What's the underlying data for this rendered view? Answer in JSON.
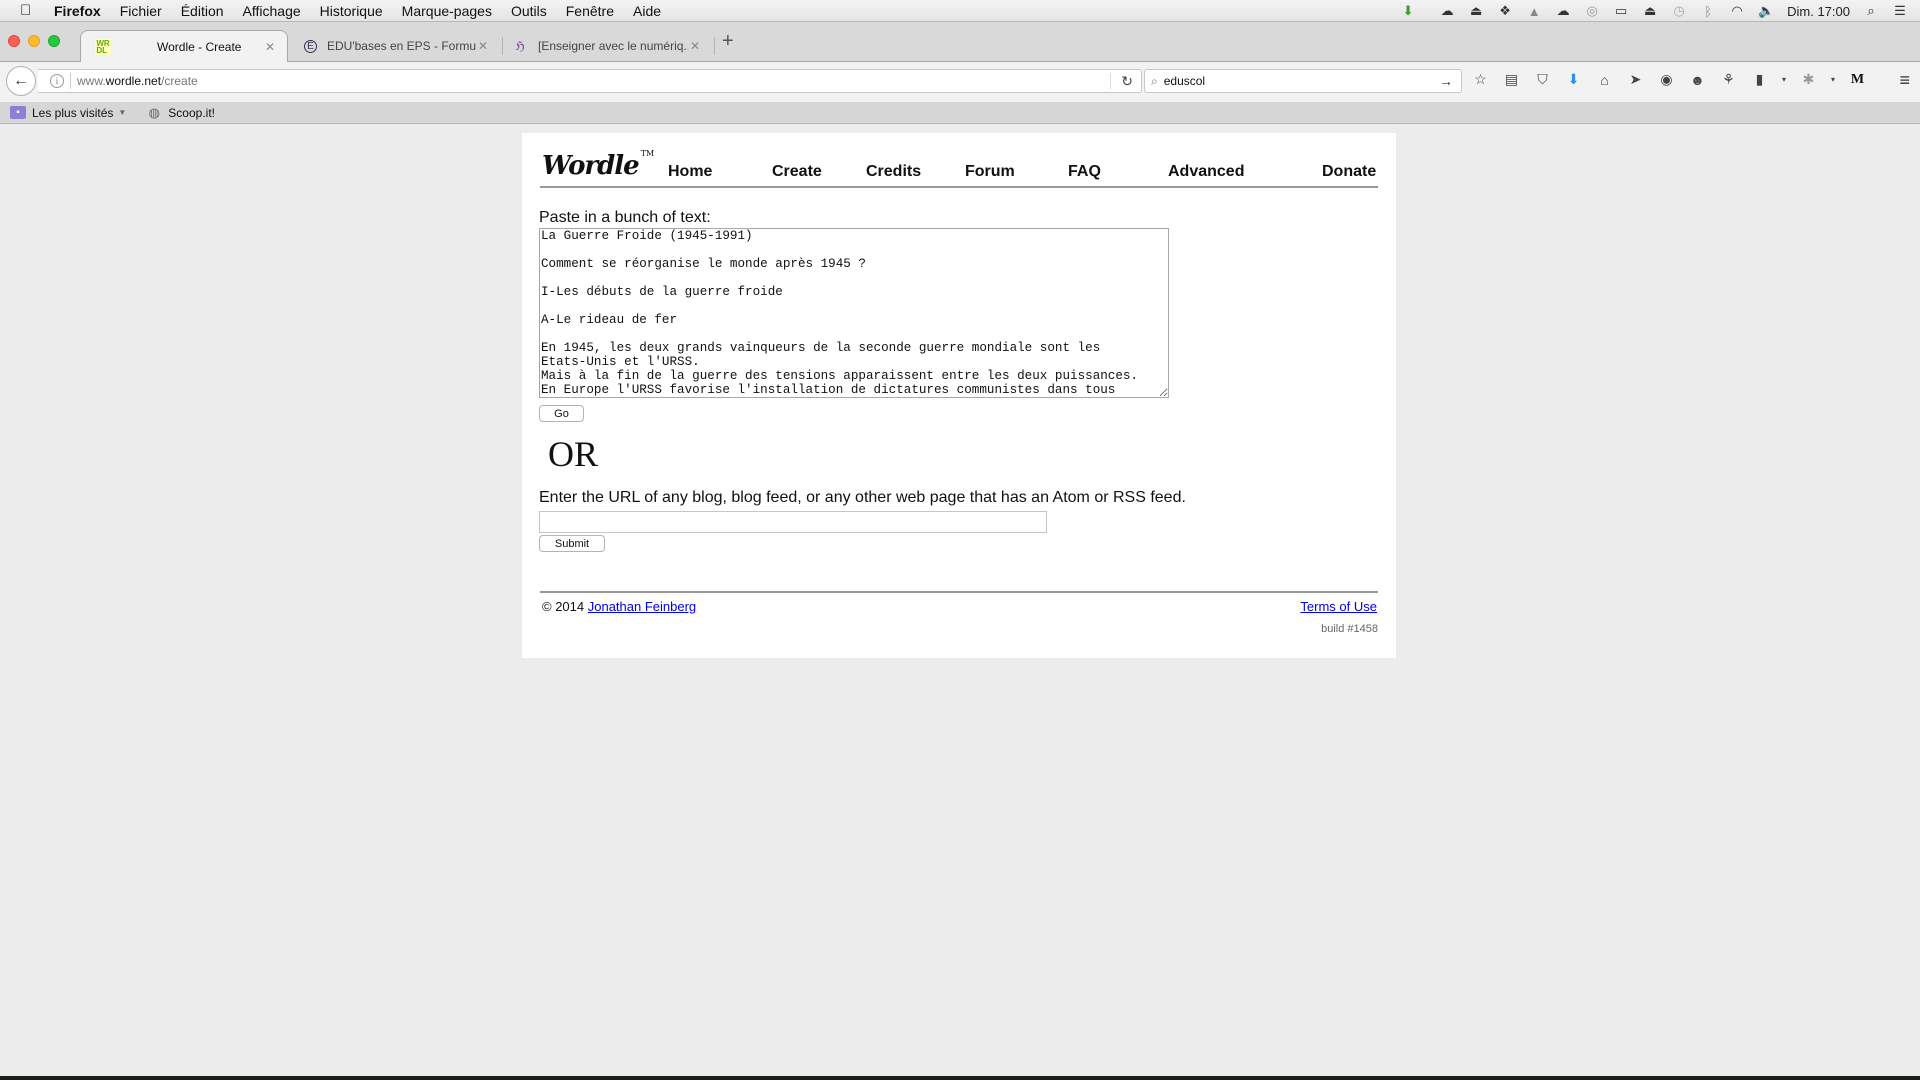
{
  "menubar": {
    "apple_icon": "",
    "app_name": "Firefox",
    "items": [
      "Fichier",
      "Édition",
      "Affichage",
      "Historique",
      "Marque-pages",
      "Outils",
      "Fenêtre",
      "Aide"
    ],
    "status_icons": [
      "download-tray-icon",
      "cloud-icon",
      "airdrop-box-icon",
      "dropbox-icon",
      "google-drive-icon",
      "creative-cloud-sync-icon",
      "adobe-cc-icon",
      "airplay-icon",
      "eject-icon",
      "time-machine-icon",
      "bluetooth-icon",
      "wifi-icon",
      "volume-icon"
    ],
    "clock": "Dim. 17:00"
  },
  "tabs": [
    {
      "title": "Wordle - Create",
      "favicon": "WR\nDL",
      "active": true
    },
    {
      "title": "EDU'bases en EPS - Formul...",
      "favicon": "É",
      "active": false
    },
    {
      "title": "[Enseigner avec le numériq...",
      "favicon": "ℌ",
      "active": false
    }
  ],
  "navbar": {
    "url_prefix": "www.",
    "url_host": "wordle.net",
    "url_path": "/create",
    "search_value": "eduscol"
  },
  "bookmarks": [
    {
      "label": "Les plus visités",
      "has_dropdown": true
    },
    {
      "label": "Scoop.it!",
      "has_dropdown": false
    }
  ],
  "page": {
    "logo": "Wordle",
    "logo_tm": "TM",
    "nav": [
      "Home",
      "Create",
      "Credits",
      "Forum",
      "FAQ",
      "Advanced",
      "Donate"
    ],
    "paste_label": "Paste in a bunch of text:",
    "textarea_value": "La Guerre Froide (1945-1991)\n\nComment se réorganise le monde après 1945 ?\n\nI-Les débuts de la guerre froide\n\nA-Le rideau de fer\n\nEn 1945, les deux grands vainqueurs de la seconde guerre mondiale sont les\nEtats-Unis et l'URSS.\nMais à la fin de la guerre des tensions apparaissent entre les deux puissances.\nEn Europe l'URSS favorise l'installation de dictatures communistes dans tous",
    "go_label": "Go",
    "or_label": "OR",
    "url_label": "Enter the URL of any blog, blog feed, or any other web page that has an Atom or RSS feed.",
    "url_value": "",
    "submit_label": "Submit",
    "copyright": "© 2014 ",
    "author": "Jonathan Feinberg",
    "terms": "Terms of Use",
    "build": "build #1458"
  }
}
